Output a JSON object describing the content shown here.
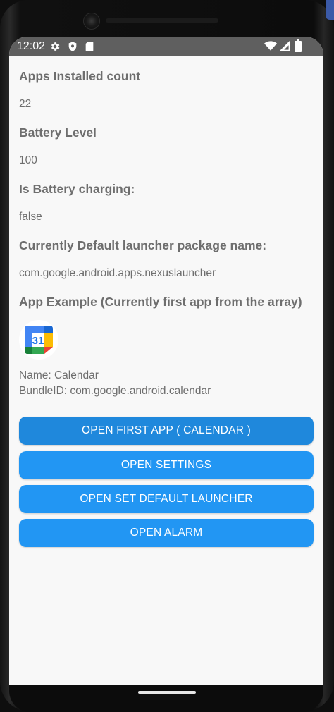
{
  "status_bar": {
    "time": "12:02",
    "icons_left": [
      "gear-icon",
      "shield-icon",
      "sd-card-icon"
    ],
    "icons_right": [
      "wifi-icon",
      "cell-signal-icon",
      "battery-icon"
    ]
  },
  "info": {
    "apps_installed_label": "Apps Installed count",
    "apps_installed_value": "22",
    "battery_level_label": "Battery Level",
    "battery_level_value": "100",
    "battery_charging_label": "Is Battery charging:",
    "battery_charging_value": "false",
    "default_launcher_label": "Currently Default launcher package name:",
    "default_launcher_value": "com.google.android.apps.nexuslauncher",
    "app_example_label": "App Example (Currently first app from the array)"
  },
  "app_example": {
    "icon": "google-calendar-icon",
    "icon_text": "31",
    "name_line": "Name: Calendar",
    "bundle_line": "BundleID: com.google.android.calendar"
  },
  "buttons": {
    "open_first_app": "OPEN FIRST APP ( CALENDAR )",
    "open_settings": "OPEN SETTINGS",
    "open_set_default_launcher": "OPEN SET DEFAULT LAUNCHER",
    "open_alarm": "OPEN ALARM"
  },
  "colors": {
    "button_bg": "#2296f3",
    "status_bar_bg": "#5f5f5f",
    "screen_bg": "#f8f8f8",
    "text": "#6e6e6e"
  }
}
